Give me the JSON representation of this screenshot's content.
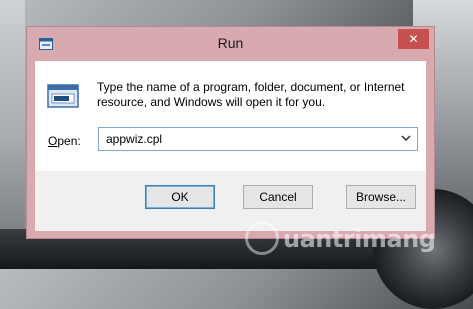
{
  "window": {
    "title": "Run",
    "close_glyph": "✕"
  },
  "dialog": {
    "description": "Type the name of a program, folder, document, or Internet resource, and Windows will open it for you.",
    "open_label_prefix": "",
    "open_label_accel": "O",
    "open_label_rest": "pen:",
    "open_value": "appwiz.cpl"
  },
  "buttons": {
    "ok": "OK",
    "cancel": "Cancel",
    "browse": "Browse..."
  },
  "watermark": {
    "text": "uantrimang"
  },
  "colors": {
    "title_bar": "#d9a9b0",
    "close_button": "#c75050",
    "accent_border": "#3c7fb1"
  }
}
